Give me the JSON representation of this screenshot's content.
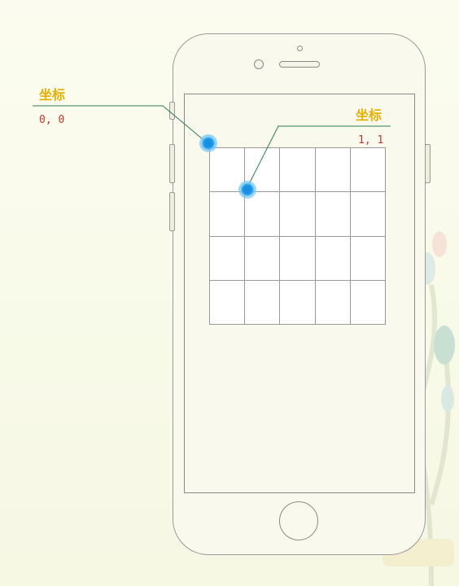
{
  "points": [
    {
      "label": "坐标",
      "coord": "0, 0"
    },
    {
      "label": "坐标",
      "coord": "1, 1"
    }
  ],
  "grid": {
    "columns": 5,
    "rows": 4
  },
  "colors": {
    "label": "#e6b000",
    "coord": "#c0392b",
    "leader": "#2e7d4f",
    "point": "#1a8fe0"
  }
}
